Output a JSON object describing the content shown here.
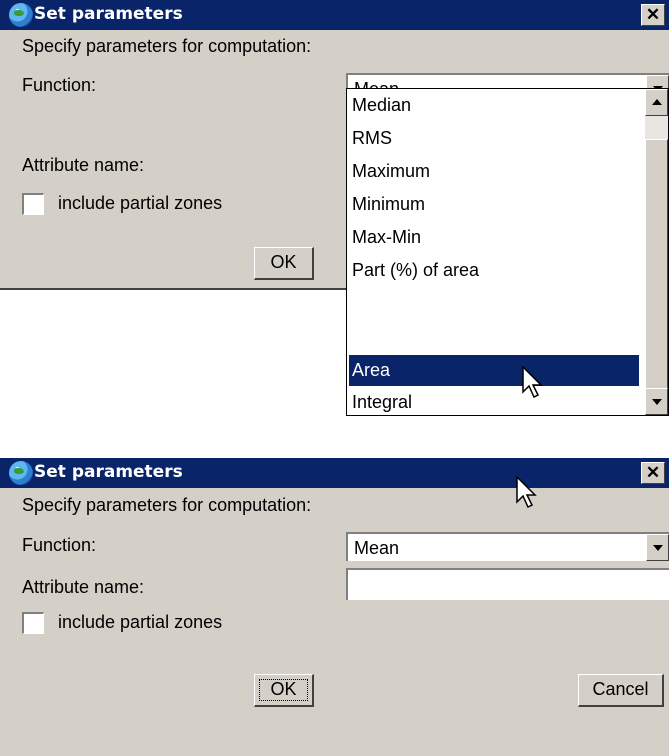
{
  "dialog_top": {
    "title": "Set parameters",
    "instructions": "Specify parameters for computation:",
    "function_label": "Function:",
    "function_value": "Mean",
    "attribute_label": "Attribute name:",
    "checkbox_label": "include partial zones",
    "ok_label": "OK",
    "dropdown_options": [
      "Median",
      "RMS",
      "Maximum",
      "Minimum",
      "Max-Min",
      "Part (%) of area",
      "Area",
      "Integral"
    ],
    "selected_option": "Area"
  },
  "dialog_bottom": {
    "title": "Set parameters",
    "instructions": "Specify parameters for computation:",
    "function_label": "Function:",
    "function_value": "Mean",
    "attribute_label": "Attribute name:",
    "attribute_value": "",
    "checkbox_label": "include partial zones",
    "ok_label": "OK",
    "cancel_label": "Cancel"
  },
  "colors": {
    "titlebar": "#0a246a",
    "dialog_bg": "#d4d0c8",
    "selection": "#0a246a"
  },
  "icons": {
    "app": "globe-icon",
    "close": "close-icon",
    "cursor": "arrow-cursor-icon"
  }
}
